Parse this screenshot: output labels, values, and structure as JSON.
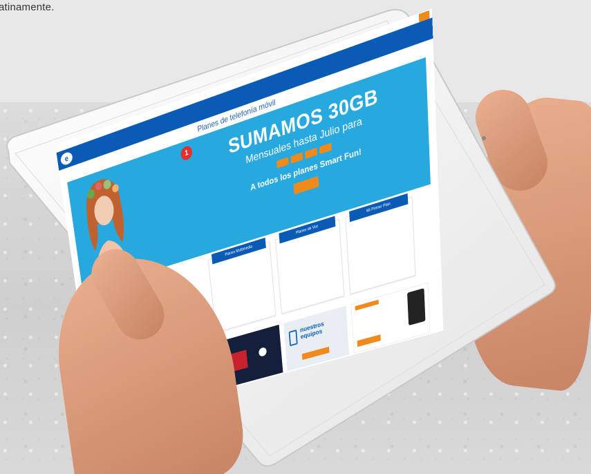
{
  "page": {
    "caption_fragment": "atinamente."
  },
  "screen": {
    "help_button": "",
    "section_title": "Planes de telefonía móvil",
    "hero": {
      "headline": "SUMAMOS 30GB",
      "subline": "Mensuales hasta Julio para",
      "line1": "A todos los planes Smart Fun!",
      "badge": "1"
    },
    "plans": [
      {
        "title": "Planes Multimedia"
      },
      {
        "title": "Planes de Voz"
      },
      {
        "title": "Mi Primer Plan"
      }
    ],
    "promo_equipment": "nuestros equipos"
  },
  "colors": {
    "brand_blue": "#0a5bb5",
    "hero_blue": "#27a8df",
    "accent_orange": "#f08a1c"
  }
}
